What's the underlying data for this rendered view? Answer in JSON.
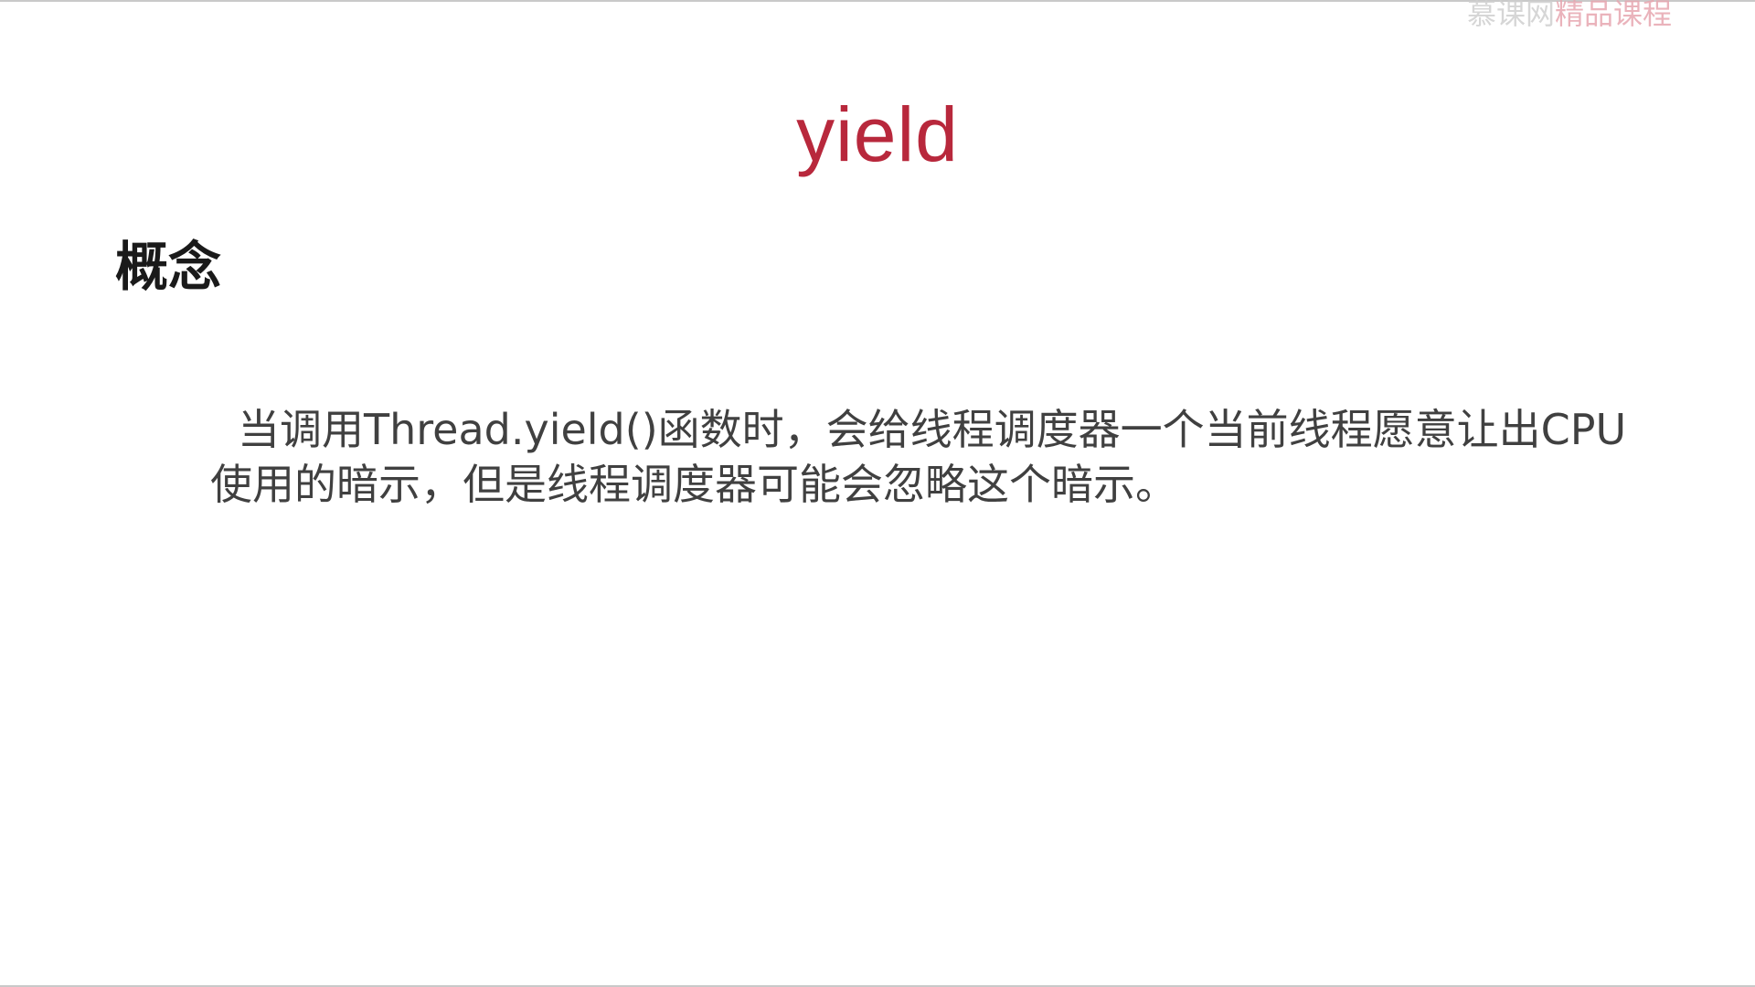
{
  "slide": {
    "title": "yield",
    "section_heading": "概念",
    "body": "当调用Thread.yield()函数时，会给线程调度器一个当前线程愿意让出CPU使用的暗示，但是线程调度器可能会忽略这个暗示。"
  },
  "colors": {
    "title": "#b8283c",
    "heading": "#1a1a1a",
    "body": "#404040",
    "background": "#ffffff"
  }
}
